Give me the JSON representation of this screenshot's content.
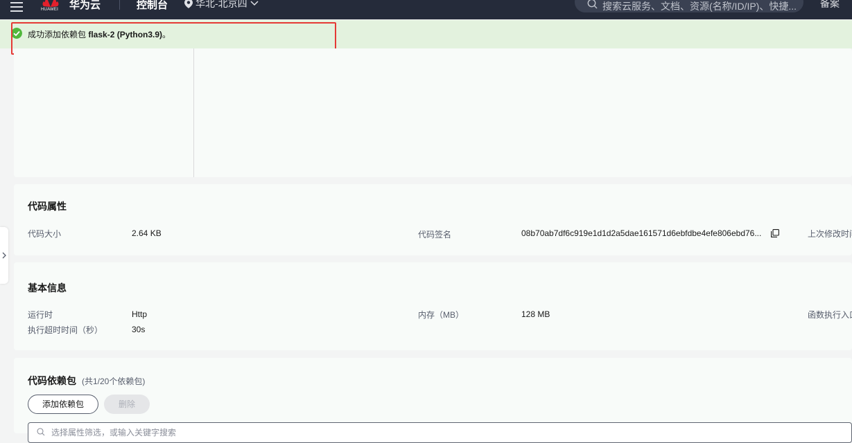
{
  "topbar": {
    "brand": "华为云",
    "logo_text": "HUAWEI",
    "console": "控制台",
    "region": "华北-北京四",
    "search_placeholder": "搜索云服务、文档、资源(名称/ID/IP)、快捷...",
    "beian": "备案"
  },
  "banner": {
    "prefix": "成功添加依赖包 ",
    "package": "flask-2 (Python3.9)",
    "suffix": "。"
  },
  "code_props": {
    "title": "代码属性",
    "size_label": "代码大小",
    "size_value": "2.64 KB",
    "sign_label": "代码签名",
    "sign_value": "08b70ab7df6c919e1d1d2a5dae161571d6ebfdbe4efe806ebd76...",
    "modified_label": "上次修改时间"
  },
  "basic_info": {
    "title": "基本信息",
    "runtime_label": "运行时",
    "runtime_value": "Http",
    "memory_label": "内存（MB）",
    "memory_value": "128 MB",
    "entry_label": "函数执行入口",
    "timeout_label": "执行超时时间（秒）",
    "timeout_value": "30s"
  },
  "deps": {
    "title": "代码依赖包",
    "count": "(共1/20个依赖包)",
    "add_button": "添加依赖包",
    "delete_button": "删除",
    "filter_placeholder": "选择属性筛选，或输入关键字搜索"
  },
  "colors": {
    "topbar_bg": "#252b3a",
    "banner_bg": "#e3f2de",
    "success_green": "#50b83c",
    "highlight_red": "#e53935"
  }
}
